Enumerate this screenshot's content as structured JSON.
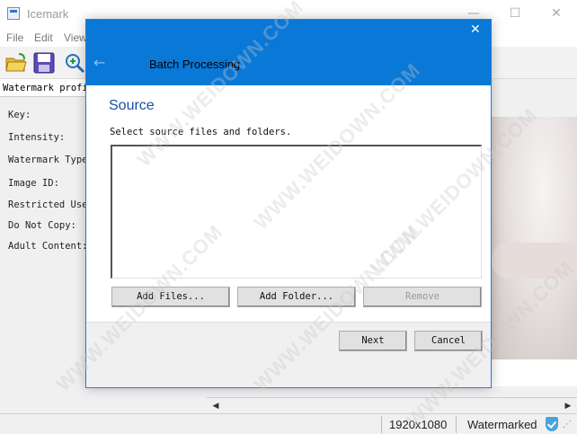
{
  "window": {
    "title": "Icemark"
  },
  "menu": [
    "File",
    "Edit",
    "View"
  ],
  "left_panel": {
    "profile_label": "Watermark profil",
    "fields": [
      "Key:",
      "Intensity:",
      "Watermark Type",
      "Image ID:",
      "Restricted Use",
      "Do Not Copy:",
      "Adult Content:"
    ]
  },
  "dialog": {
    "title": "Batch Processing",
    "section": "Source",
    "instruction": "Select source files and folders.",
    "add_files": "Add Files...",
    "add_folder": "Add Folder...",
    "remove": "Remove",
    "next": "Next",
    "cancel": "Cancel"
  },
  "status": {
    "resolution": "1920x1080",
    "state": "Watermarked"
  },
  "watermark_text": "WWW.WEIDOWN.COM",
  "colors": {
    "dialog_header": "#0a78d7",
    "section_title": "#1a4fa6"
  },
  "icons": [
    "app-icon",
    "minimize-icon",
    "maximize-icon",
    "close-icon",
    "open-folder-icon",
    "save-icon",
    "zoom-icon",
    "back-arrow-icon",
    "shield-check-icon",
    "resize-grip-icon"
  ]
}
